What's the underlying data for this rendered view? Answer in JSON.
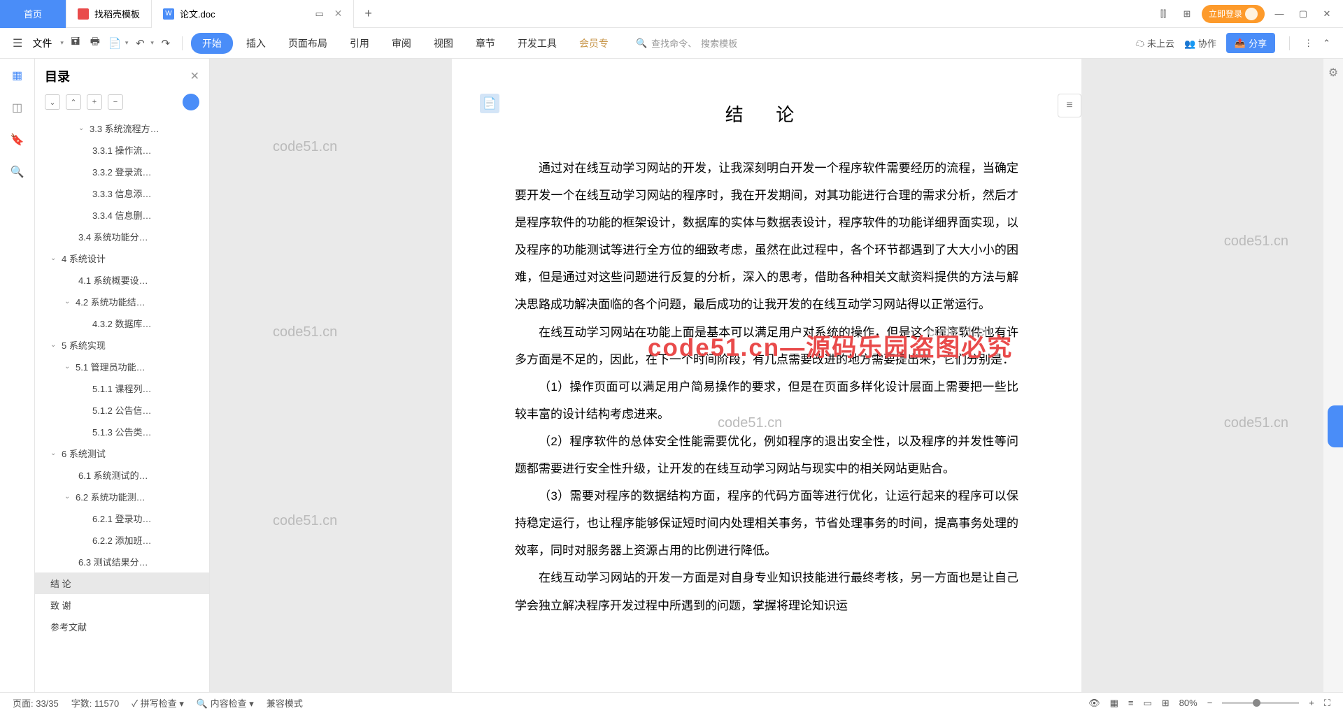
{
  "tabs": {
    "home": "首页",
    "t1": "找稻壳模板",
    "t2": "论文.doc"
  },
  "login": "立即登录",
  "toolbar": {
    "file": "文件"
  },
  "ribbon": {
    "start": "开始",
    "insert": "插入",
    "layout": "页面布局",
    "ref": "引用",
    "review": "审阅",
    "view": "视图",
    "chapter": "章节",
    "dev": "开发工具",
    "vip": "会员专"
  },
  "search": {
    "cmd": "查找命令、",
    "tpl": "搜索模板"
  },
  "rtools": {
    "cloud": "未上云",
    "collab": "协作",
    "share": "分享"
  },
  "outline": {
    "title": "目录"
  },
  "tree": {
    "i0": "3.3 系统流程方…",
    "i1": "3.3.1 操作流…",
    "i2": "3.3.2 登录流…",
    "i3": "3.3.3 信息添…",
    "i4": "3.3.4 信息删…",
    "i5": "3.4 系统功能分…",
    "i6": "4 系统设计",
    "i7": "4.1 系统概要设…",
    "i8": "4.2 系统功能结…",
    "i9": "4.3.2 数据库…",
    "i10": "5 系统实现",
    "i11": "5.1 管理员功能…",
    "i12": "5.1.1 课程列…",
    "i13": "5.1.2 公告信…",
    "i14": "5.1.3 公告类…",
    "i15": "6 系统测试",
    "i16": "6.1 系统测试的…",
    "i17": "6.2 系统功能测…",
    "i18": "6.2.1 登录功…",
    "i19": "6.2.2 添加班…",
    "i20": "6.3 测试结果分…",
    "i21": "结 论",
    "i22": "致 谢",
    "i23": "参考文献"
  },
  "doc": {
    "title": "结 论",
    "p1": "通过对在线互动学习网站的开发，让我深刻明白开发一个程序软件需要经历的流程，当确定要开发一个在线互动学习网站的程序时，我在开发期间，对其功能进行合理的需求分析，然后才是程序软件的功能的框架设计，数据库的实体与数据表设计，程序软件的功能详细界面实现，以及程序的功能测试等进行全方位的细致考虑，虽然在此过程中，各个环节都遇到了大大小小的困难，但是通过对这些问题进行反复的分析，深入的思考，借助各种相关文献资料提供的方法与解决思路成功解决面临的各个问题，最后成功的让我开发的在线互动学习网站得以正常运行。",
    "p2": "在线互动学习网站在功能上面是基本可以满足用户对系统的操作，但是这个程序软件也有许多方面是不足的，因此，在下一个时间阶段，有几点需要改进的地方需要提出来，它们分别是：",
    "p3": "（1）操作页面可以满足用户简易操作的要求，但是在页面多样化设计层面上需要把一些比较丰富的设计结构考虑进来。",
    "p4": "（2）程序软件的总体安全性能需要优化，例如程序的退出安全性，以及程序的并发性等问题都需要进行安全性升级，让开发的在线互动学习网站与现实中的相关网站更贴合。",
    "p5": "（3）需要对程序的数据结构方面，程序的代码方面等进行优化，让运行起来的程序可以保持稳定运行，也让程序能够保证短时间内处理相关事务，节省处理事务的时间，提高事务处理的效率，同时对服务器上资源占用的比例进行降低。",
    "p6": "在线互动学习网站的开发一方面是对自身专业知识技能进行最终考核，另一方面也是让自己学会独立解决程序开发过程中所遇到的问题，掌握将理论知识运"
  },
  "wm": "code51.cn",
  "wm_red": "code51.cn—源码乐园盗图必究",
  "status": {
    "page": "页面: 33/35",
    "words": "字数: 11570",
    "spell": "拼写检查",
    "content": "内容检查",
    "compat": "兼容模式",
    "zoom": "80%"
  }
}
